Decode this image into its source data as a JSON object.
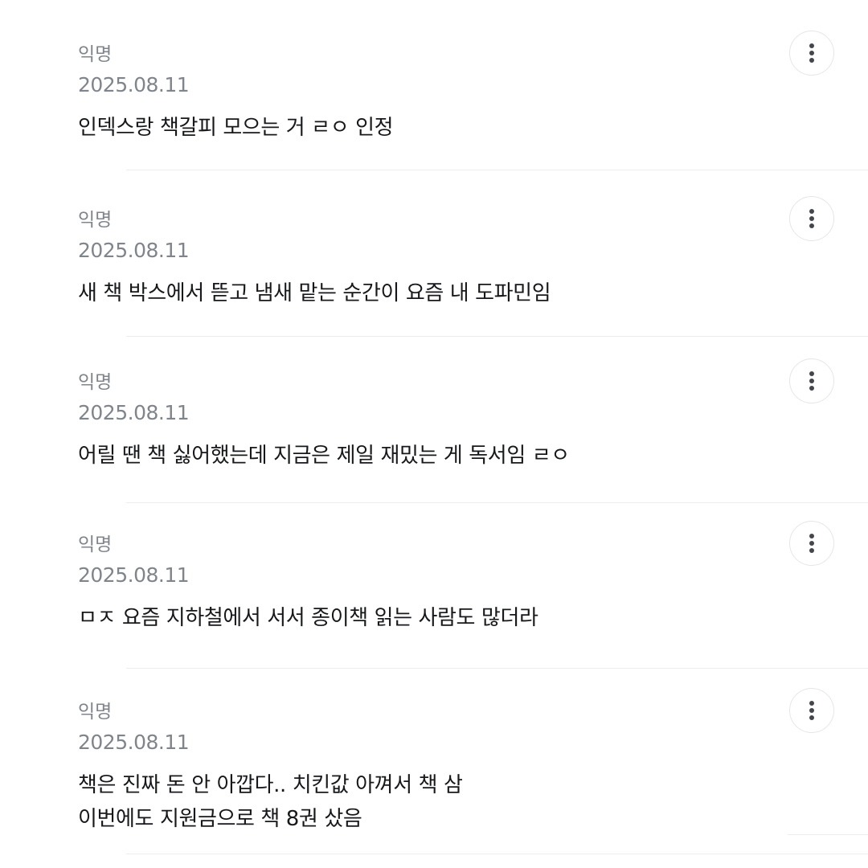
{
  "comments": [
    {
      "author": "익명",
      "date": "2025.08.11",
      "text": "인덱스랑 책갈피 모으는 거 ㄹㅇ 인정"
    },
    {
      "author": "익명",
      "date": "2025.08.11",
      "text": "새 책 박스에서 뜯고 냄새 맡는 순간이 요즘 내 도파민임"
    },
    {
      "author": "익명",
      "date": "2025.08.11",
      "text": "어릴 땐 책 싫어했는데 지금은 제일 재밌는 게 독서임 ㄹㅇ"
    },
    {
      "author": "익명",
      "date": "2025.08.11",
      "text": "ㅁㅈ 요즘 지하철에서 서서 종이책 읽는 사람도 많더라"
    },
    {
      "author": "익명",
      "date": "2025.08.11",
      "text": "책은 진짜 돈 안 아깝다.. 치킨값 아껴서 책 삼\n이번에도 지원금으로 책 8권 샀음"
    }
  ],
  "icons": {
    "more": "more-vertical-icon"
  },
  "colors": {
    "meta_text": "#80858c",
    "body_text": "#16181b",
    "divider": "#ebedf0",
    "button_border": "#e4e6e9"
  }
}
